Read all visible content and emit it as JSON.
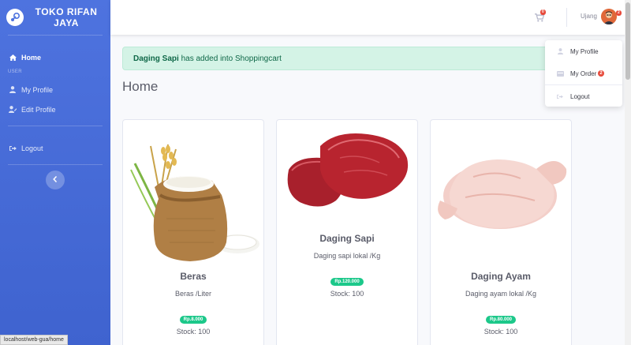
{
  "brand": {
    "name": "TOKO RIFAN JAYA"
  },
  "sidebar": {
    "items": [
      {
        "label": "Home",
        "icon": "home-icon"
      },
      {
        "label": "My Profile",
        "icon": "user-icon"
      },
      {
        "label": "Edit Profile",
        "icon": "user-edit-icon"
      },
      {
        "label": "Logout",
        "icon": "sign-out-icon"
      }
    ],
    "heading_user": "USER"
  },
  "topbar": {
    "cart_count": "0",
    "username": "Ujang",
    "avatar_badge": "2"
  },
  "alert": {
    "product": "Daging Sapi",
    "message": " has added into Shoppingcart"
  },
  "page": {
    "title": "Home"
  },
  "dropdown": {
    "items": [
      {
        "label": "My Profile",
        "icon": "user-icon"
      },
      {
        "label": "My Order",
        "icon": "order-icon",
        "badge": "2"
      },
      {
        "label": "Logout",
        "icon": "sign-out-icon"
      }
    ]
  },
  "products": [
    {
      "name": "Beras",
      "desc": "Beras /Liter",
      "price": "Rp.8.000",
      "stock": "Stock: 100"
    },
    {
      "name": "Daging Sapi",
      "desc": "Daging sapi lokal /Kg",
      "price": "Rp.120.000",
      "stock": "Stock: 100"
    },
    {
      "name": "Daging Ayam",
      "desc": "Daging ayam lokal /Kg",
      "price": "Rp.80.000",
      "stock": "Stock: 100"
    }
  ],
  "statusbar": {
    "url": "localhost/web-gua/home"
  },
  "colors": {
    "primary": "#4e73df",
    "success": "#1cc88a",
    "danger": "#e74a3b"
  }
}
